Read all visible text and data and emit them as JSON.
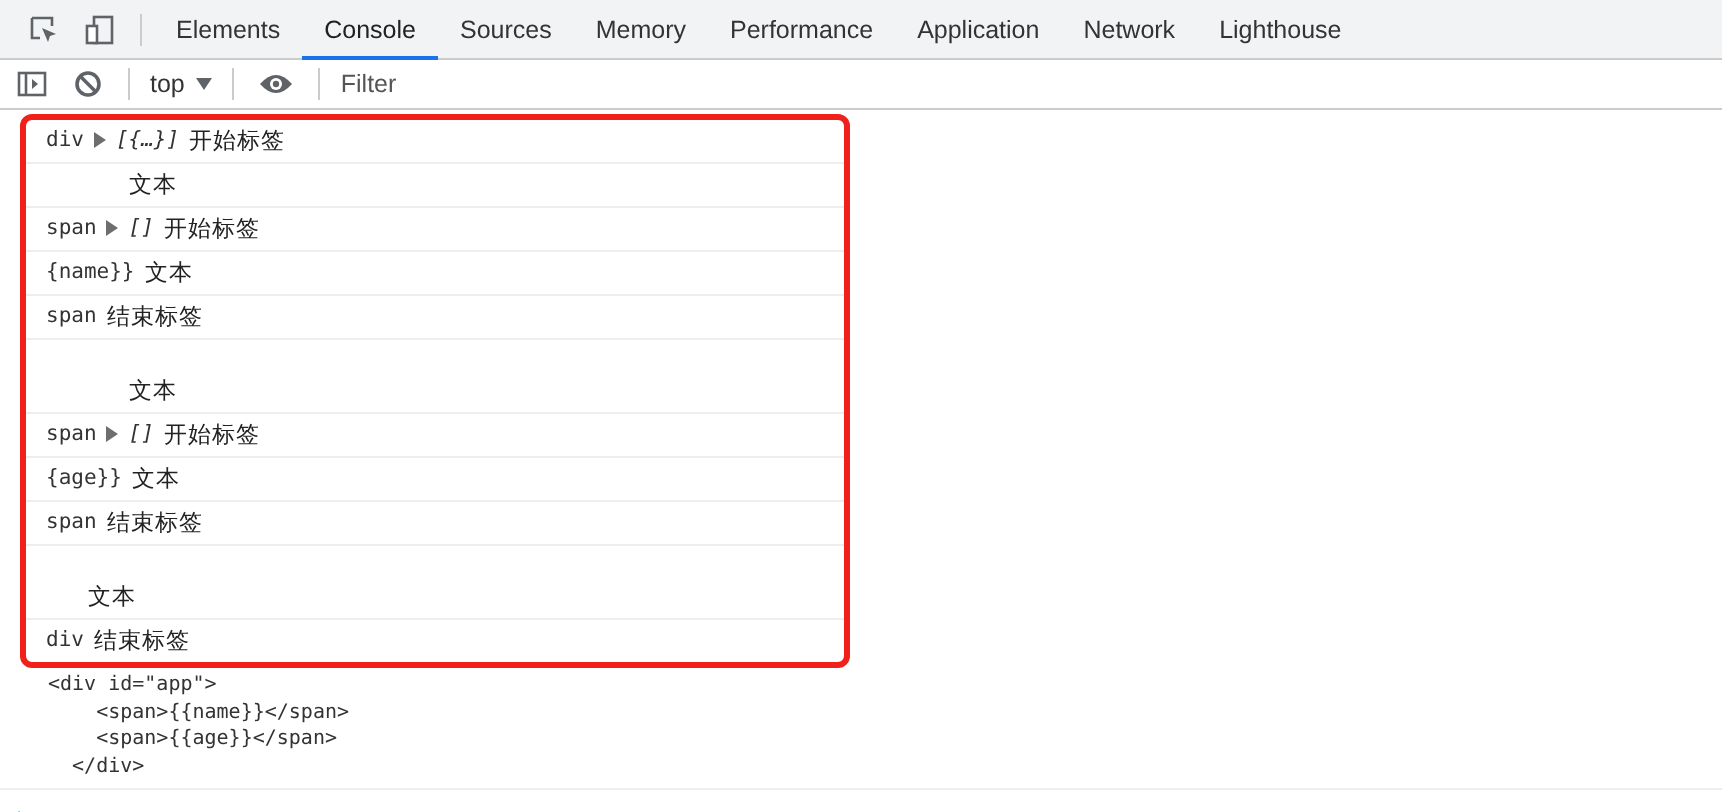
{
  "tabs": [
    {
      "label": "Elements",
      "selected": false
    },
    {
      "label": "Console",
      "selected": true
    },
    {
      "label": "Sources",
      "selected": false
    },
    {
      "label": "Memory",
      "selected": false
    },
    {
      "label": "Performance",
      "selected": false
    },
    {
      "label": "Application",
      "selected": false
    },
    {
      "label": "Network",
      "selected": false
    },
    {
      "label": "Lighthouse",
      "selected": false
    }
  ],
  "toolbar": {
    "context": "top",
    "filter": {
      "placeholder": "Filter"
    }
  },
  "console": {
    "highlighted_rows": [
      {
        "tag": "div",
        "expand": "[{…}]",
        "message": "开始标签"
      },
      {
        "message": "      文本"
      },
      {
        "tag": "span",
        "expand": "[]",
        "message": "开始标签"
      },
      {
        "tag": "{name}}",
        "message": "文本"
      },
      {
        "tag": "span",
        "message": "结束标签"
      },
      {
        "message": "\n      文本"
      },
      {
        "tag": "span",
        "expand": "[]",
        "message": "开始标签"
      },
      {
        "tag": "{age}}",
        "message": "文本"
      },
      {
        "tag": "span",
        "message": "结束标签"
      },
      {
        "message": "\n   文本"
      },
      {
        "tag": "div",
        "message": "结束标签"
      }
    ],
    "output": "<div id=\"app\">\n    <span>{{name}}</span>\n    <span>{{age}}</span>\n  </div>"
  }
}
